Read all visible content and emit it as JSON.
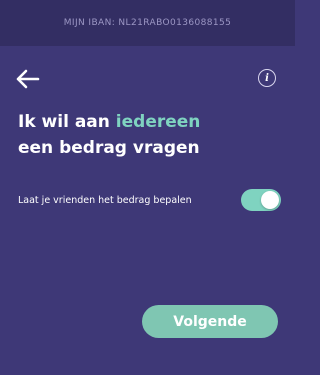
{
  "header": {
    "iban_label": "MIJN IBAN: NL21RABO0136088155"
  },
  "nav": {
    "back_icon": "arrow-left-icon",
    "info_icon": "info-icon",
    "info_glyph": "i"
  },
  "main": {
    "title_part1": "Ik wil aan ",
    "title_accent": "iedereen",
    "title_part2": "een bedrag vragen",
    "toggle_label": "Laat je vrienden het bedrag bepalen",
    "toggle_on": true,
    "next_label": "Volgende"
  },
  "colors": {
    "background": "#3e3877",
    "header_background": "#332e63",
    "accent": "#7fd3c0",
    "button": "#7fc6b2"
  }
}
